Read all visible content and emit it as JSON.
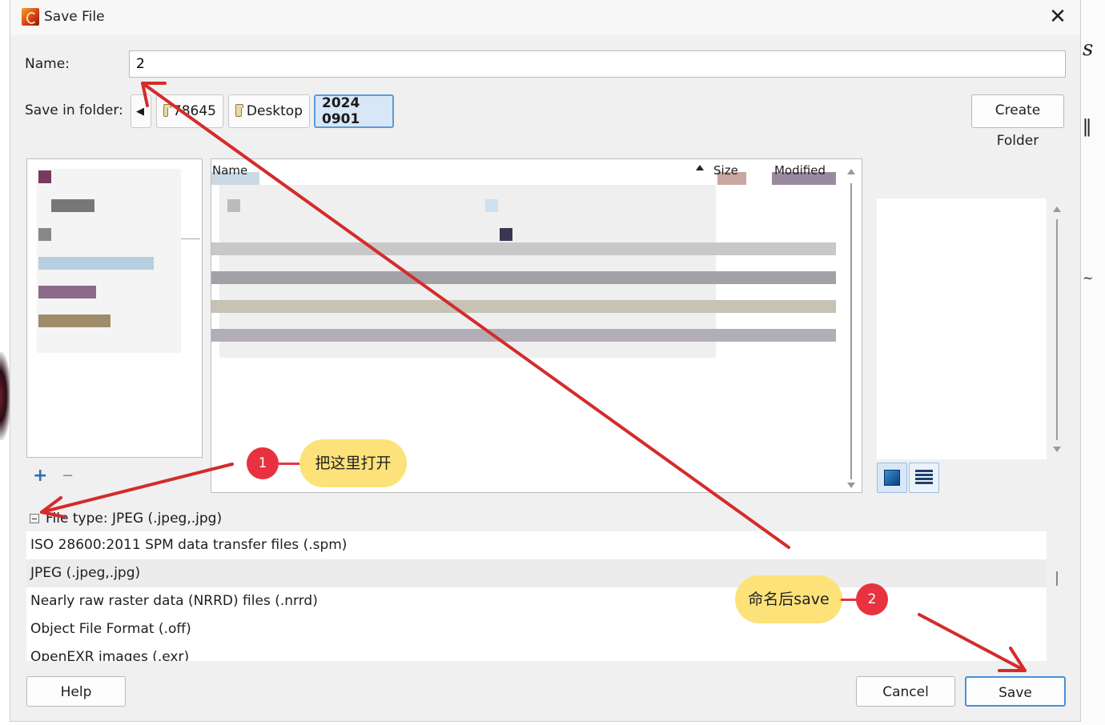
{
  "window": {
    "title": "Save File"
  },
  "name_field": {
    "label": "Name:",
    "value": "2"
  },
  "folder": {
    "label": "Save in folder:",
    "crumbs": [
      "78645",
      "Desktop",
      "2024 0901"
    ],
    "create_folder": "Create Folder"
  },
  "columns": {
    "name": "Name",
    "size": "Size",
    "modified": "Modified"
  },
  "places": {
    "add": "+",
    "remove": "−"
  },
  "file_type": {
    "label": "File type: JPEG (.jpeg,.jpg)",
    "options": [
      "ISO 28600:2011 SPM data transfer files (.spm)",
      "JPEG (.jpeg,.jpg)",
      "Nearly raw raster data (NRRD) files (.nrrd)",
      "Object File Format (.off)",
      "OpenEXR images (.exr)"
    ],
    "selected_index": 1
  },
  "buttons": {
    "help": "Help",
    "cancel": "Cancel",
    "save": "Save"
  },
  "annotations": {
    "step1": {
      "number": "1",
      "text": "把这里打开"
    },
    "step2": {
      "number": "2",
      "text": "命名后save"
    }
  },
  "colors": {
    "annotation_red": "#e8323f",
    "bubble_yellow": "#fde27a",
    "accent_blue": "#4a8fd6"
  }
}
